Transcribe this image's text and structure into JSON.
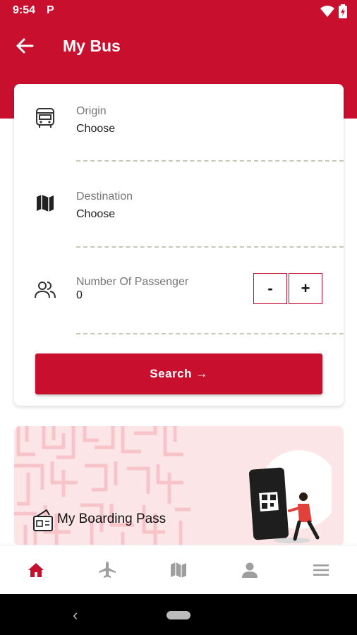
{
  "status_bar": {
    "time": "9:54",
    "app_icon_letter": "P",
    "icons": [
      "wifi-icon",
      "battery-icon"
    ]
  },
  "header": {
    "title": "My Bus",
    "back_icon": "arrow-left-icon"
  },
  "search_form": {
    "origin": {
      "label": "Origin",
      "value": "Choose",
      "icon": "bus-icon"
    },
    "destination": {
      "label": "Destination",
      "value": "Choose",
      "icon": "map-icon"
    },
    "passengers": {
      "label": "Number Of Passenger",
      "value": "0",
      "icon": "people-icon",
      "decrement_label": "-",
      "increment_label": "+"
    },
    "search_label": "Search →"
  },
  "promo": {
    "label": "My Boarding Pass",
    "icon": "boarding-pass-icon"
  },
  "bottom_nav": {
    "items": [
      "home-icon",
      "flight-icon",
      "map-icon",
      "profile-icon",
      "menu-icon"
    ],
    "active_index": 0
  },
  "colors": {
    "primary": "#c8102e",
    "promo_background": "#fce5e7",
    "divider": "#c9c9b8",
    "inactive_icon": "#9e9e9e"
  }
}
